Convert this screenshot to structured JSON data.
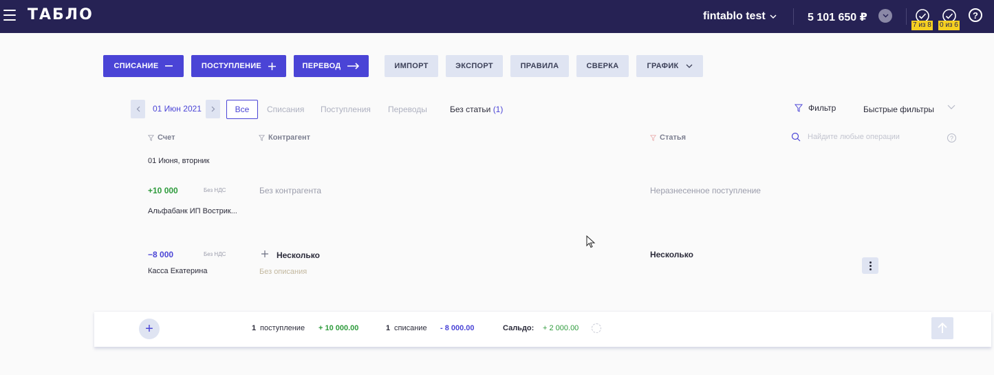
{
  "header": {
    "logo": "ТАБЛО",
    "company": "fintablo test",
    "balance": "5 101 650 ₽",
    "tasks": [
      {
        "badge": "7 из 8"
      },
      {
        "badge": "0 из 6"
      }
    ],
    "help": "?"
  },
  "actions": {
    "writeoff": "СПИСАНИЕ",
    "income": "ПОСТУПЛЕНИЕ",
    "transfer": "ПЕРЕВОД",
    "import": "ИМПОРТ",
    "export": "ЭКСПОРТ",
    "rules": "ПРАВИЛА",
    "reconcile": "СВЕРКА",
    "schedule": "ГРАФИК"
  },
  "filters": {
    "date": "01 Июн 2021",
    "tabs": {
      "all": "Все",
      "writeoffs": "Списания",
      "incomes": "Поступления",
      "transfers": "Переводы",
      "no_category": "Без статьи",
      "no_category_count": "(1)"
    },
    "filter": "Фильтр",
    "quick_filters": "Быстрые фильтры"
  },
  "columns": {
    "account": "Счет",
    "counterparty": "Контрагент",
    "category": "Статья",
    "search_placeholder": "Найдите любые операции"
  },
  "day_label": "01 Июня, вторник",
  "operations": [
    {
      "amount": "+10 000",
      "vat": "Без НДС",
      "account": "Альфабанк ИП Вострик...",
      "counterparty": "Без контрагента",
      "category": "Неразнесенное поступление"
    },
    {
      "amount": "−8 000",
      "vat": "Без НДС",
      "account": "Касса Екатерина",
      "counterparty": "Несколько",
      "description": "Без описания",
      "category": "Несколько"
    }
  ],
  "footer": {
    "income_count": "1",
    "income_label": "поступление",
    "income_sum": "+ 10 000.00",
    "writeoff_count": "1",
    "writeoff_label": "списание",
    "writeoff_sum": "- 8 000.00",
    "saldo_label": "Сальдо:",
    "saldo_sum": "+ 2 000.00"
  },
  "colors": {
    "topbar": "#262254",
    "primary": "#4a44d6",
    "secondary": "#dfe4f2",
    "positive": "#2e9b3c",
    "badge": "#f5d020"
  }
}
